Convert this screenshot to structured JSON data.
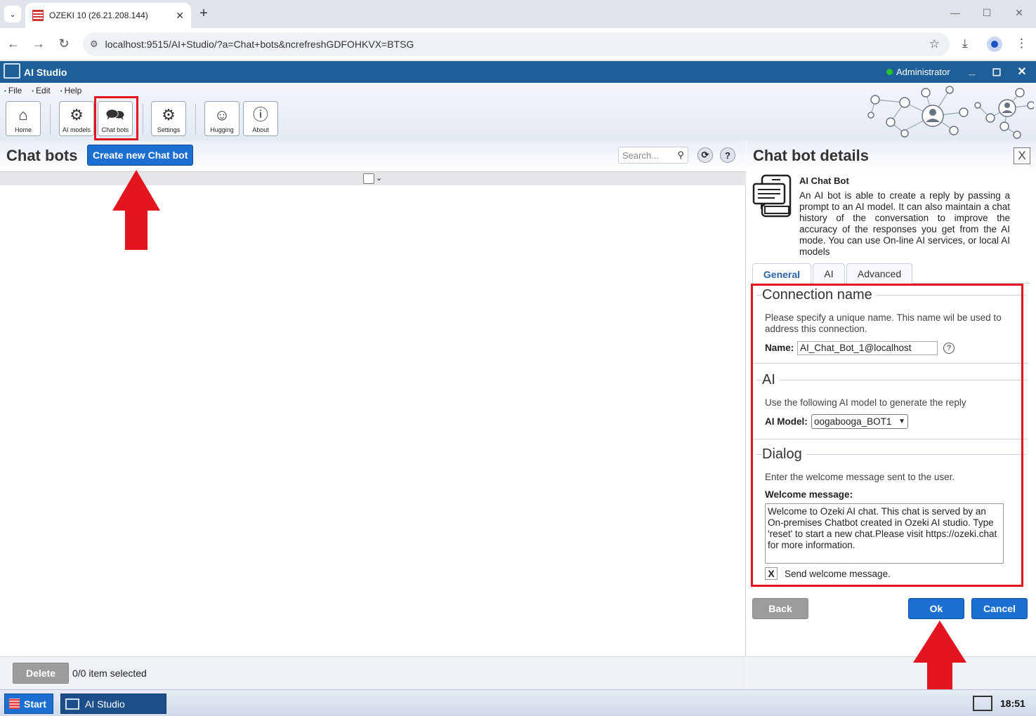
{
  "browser": {
    "tab_title": "OZEKI 10 (26.21.208.144)",
    "url": "localhost:9515/AI+Studio/?a=Chat+bots&ncrefreshGDFOHKVX=BTSG"
  },
  "app": {
    "title": "AI Studio",
    "user": "Administrator"
  },
  "menu": [
    "File",
    "Edit",
    "Help"
  ],
  "toolbar": {
    "home": "Home",
    "ai_models": "AI models",
    "chat_bots": "Chat bots",
    "settings": "Settings",
    "hugging": "Hugging",
    "about": "About"
  },
  "left_panel": {
    "title": "Chat bots",
    "create_button": "Create new Chat bot",
    "search_placeholder": "Search...",
    "help": "?",
    "delete_button": "Delete",
    "selection_status": "0/0 item selected"
  },
  "right_panel": {
    "title": "Chat bot details",
    "close": "X",
    "bot_name": "AI Chat Bot",
    "bot_description": "An AI bot is able to create a reply by passing a prompt to an AI model. It can also maintain a chat history of the conversation to improve the accuracy of the responses you get from the AI mode. You can use On-line AI services, or local AI models",
    "tabs": [
      "General",
      "AI",
      "Advanced"
    ],
    "connection": {
      "legend": "Connection name",
      "help": "Please specify a unique name. This name wil be used to address this connection.",
      "name_label": "Name:",
      "name_value": "AI_Chat_Bot_1@localhost",
      "help_icon": "?"
    },
    "ai": {
      "legend": "AI",
      "help": "Use the following AI model to generate the reply",
      "model_label": "AI Model:",
      "model_value": "oogabooga_BOT1"
    },
    "dialog": {
      "legend": "Dialog",
      "help": "Enter the welcome message sent to the user.",
      "welcome_label": "Welcome message:",
      "welcome_value": "Welcome to Ozeki AI chat. This chat is served by an On-premises Chatbot created in Ozeki AI studio. Type 'reset' to start a new chat.Please visit https://ozeki.chat for more information.",
      "send_checkbox_mark": "X",
      "send_label": "Send welcome message."
    },
    "back_button": "Back",
    "ok_button": "Ok",
    "cancel_button": "Cancel"
  },
  "taskbar": {
    "start": "Start",
    "app_item": "AI Studio",
    "clock": "18:51"
  },
  "colors": {
    "accent": "#1c6fd1",
    "header": "#1f5f99",
    "annotation_red": "#e3161f",
    "status_online": "#26c22a"
  }
}
